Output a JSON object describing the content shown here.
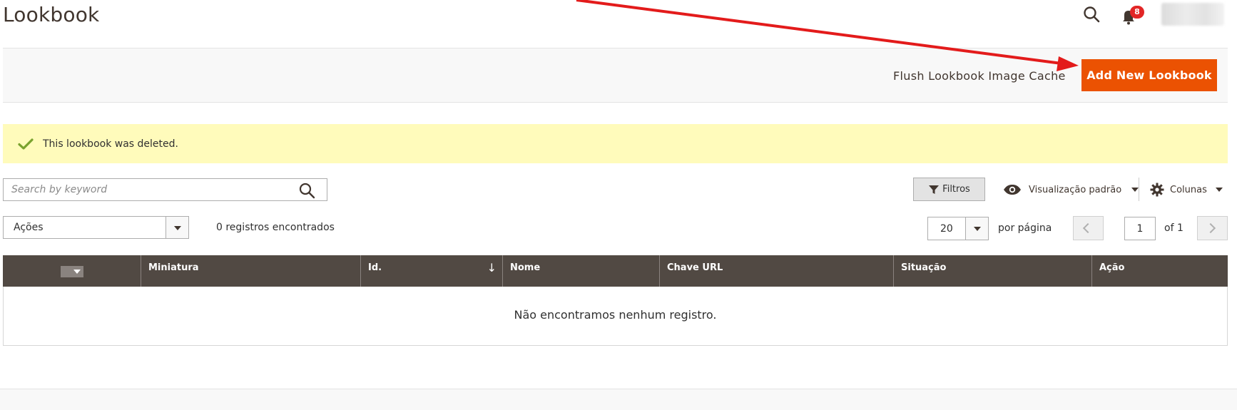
{
  "header": {
    "title": "Lookbook",
    "notifications_count": "8",
    "search_icon": "search-icon",
    "bell_icon": "bell-icon"
  },
  "action_bar": {
    "flush_label": "Flush Lookbook Image Cache",
    "add_label": "Add New Lookbook"
  },
  "message": {
    "text": "This lookbook was deleted.",
    "icon": "checkmark-icon"
  },
  "toolbar": {
    "search_placeholder": "Search by keyword",
    "filters_label": "Filtros",
    "view_label": "Visualização padrão",
    "columns_label": "Colunas",
    "actions_label": "Ações",
    "records_label": "0 registros encontrados",
    "per_page_value": "20",
    "per_page_label": "por página",
    "page_value": "1",
    "of_label": "of 1"
  },
  "grid": {
    "columns": [
      "",
      "Miniatura",
      "Id.",
      "Nome",
      "Chave URL",
      "Situação",
      "Ação"
    ],
    "sorted_column": "Id.",
    "empty_text": "Não encontramos nenhum registro."
  },
  "colors": {
    "accent": "#eb5202",
    "grid_header": "#514943",
    "message_bg": "#fffbbb",
    "annotation_arrow": "#e31b1b"
  }
}
